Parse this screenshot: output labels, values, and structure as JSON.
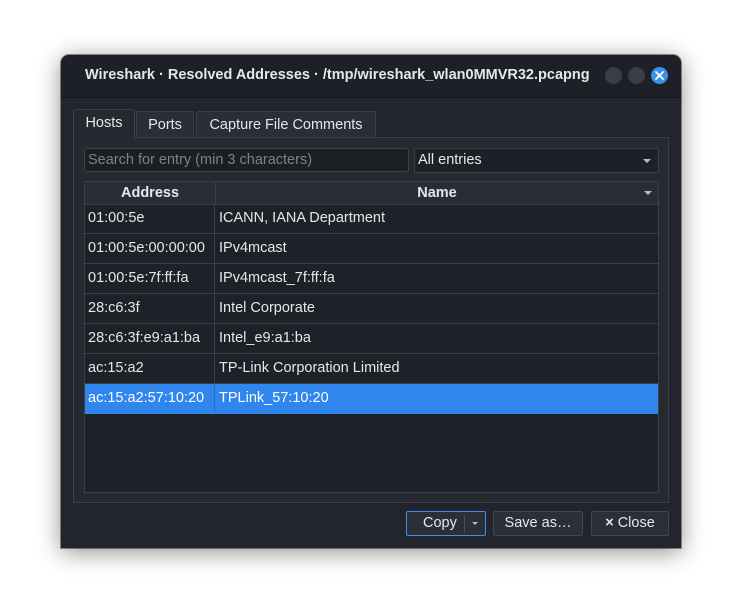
{
  "window": {
    "title": "Wireshark · Resolved Addresses · /tmp/wireshark_wlan0MMVR32.pcapng",
    "accent": "#3d8fe9"
  },
  "tabs": [
    {
      "label": "Hosts",
      "active": true
    },
    {
      "label": "Ports",
      "active": false
    },
    {
      "label": "Capture File Comments",
      "active": false
    }
  ],
  "search": {
    "placeholder": "Search for entry (min 3 characters)",
    "value": ""
  },
  "filter": {
    "selected": "All entries"
  },
  "table": {
    "columns": [
      "Address",
      "Name"
    ],
    "rows": [
      {
        "address": "01:00:5e",
        "name": "ICANN, IANA Department"
      },
      {
        "address": "01:00:5e:00:00:00",
        "name": "IPv4mcast"
      },
      {
        "address": "01:00:5e:7f:ff:fa",
        "name": "IPv4mcast_7f:ff:fa"
      },
      {
        "address": "28:c6:3f",
        "name": "Intel Corporate"
      },
      {
        "address": "28:c6:3f:e9:a1:ba",
        "name": "Intel_e9:a1:ba"
      },
      {
        "address": "ac:15:a2",
        "name": "TP-Link Corporation Limited"
      },
      {
        "address": "ac:15:a2:57:10:20",
        "name": "TPLink_57:10:20",
        "selected": true
      }
    ]
  },
  "buttons": {
    "copy": "Copy",
    "save_as": "Save as…",
    "close": "Close",
    "close_icon": "×"
  }
}
